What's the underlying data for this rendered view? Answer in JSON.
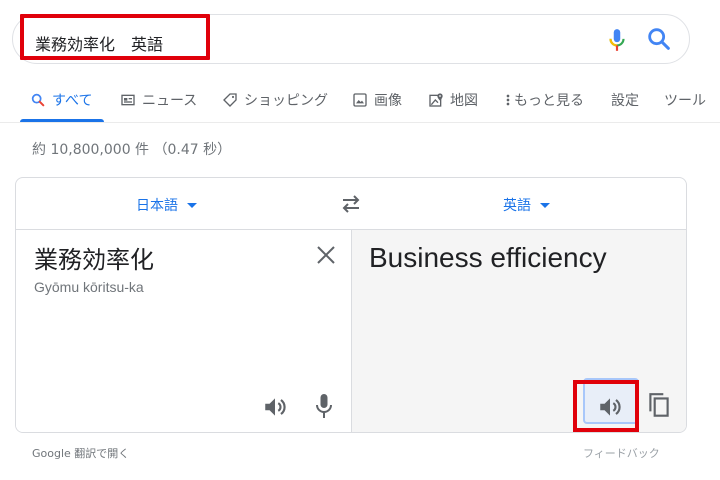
{
  "search": {
    "query": "業務効率化　英語"
  },
  "tabs": [
    {
      "label": "すべて",
      "icon": "search-icon"
    },
    {
      "label": "ニュース",
      "icon": "news-icon"
    },
    {
      "label": "ショッピング",
      "icon": "tag-icon"
    },
    {
      "label": "画像",
      "icon": "image-icon"
    },
    {
      "label": "地図",
      "icon": "map-icon"
    },
    {
      "label": "もっと見る",
      "icon": "more-vertical-icon"
    },
    {
      "label": "設定"
    },
    {
      "label": "ツール"
    }
  ],
  "result_stats": "約 10,800,000 件 （0.47 秒）",
  "translate": {
    "source_lang": "日本語",
    "target_lang": "英語",
    "source_text": "業務効率化",
    "source_romanization": "Gyōmu kōritsu-ka",
    "target_text": "Business efficiency"
  },
  "footer": {
    "open_link": "Google 翻訳で開く",
    "feedback": "フィードバック"
  },
  "colors": {
    "accent": "#1a73e8",
    "highlight": "#e0000a"
  }
}
